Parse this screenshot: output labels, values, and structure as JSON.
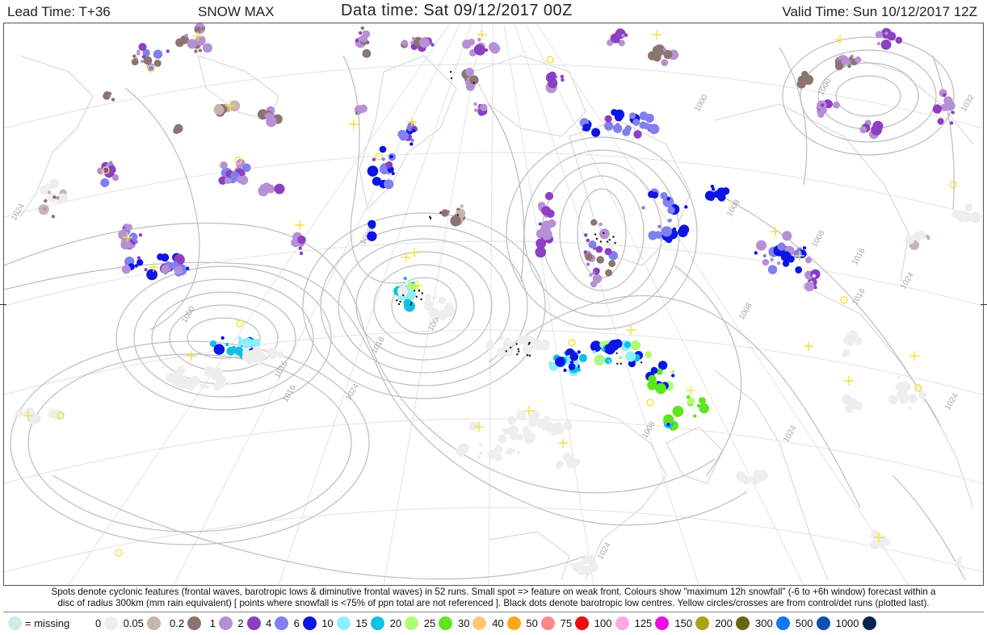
{
  "header": {
    "lead_time": "Lead Time: T+36",
    "product": "SNOW MAX",
    "data_time": "Data time:  Sat 09/12/2017 00Z",
    "valid_time": "Valid Time: Sun 10/12/2017 12Z"
  },
  "caption": {
    "line1": "Spots denote cyclonic features (frontal waves, barotropic lows & diminutive frontal waves) in 52 runs. Small spot => feature on weak front. Colours show \"maximum 12h snowfall\" (-6 to +6h window) forecast within a",
    "line2": "disc of radius 300km (mm rain equivalent) [ points where snowfall is <75% of ppn total are not referenced ]. Black dots denote barotropic low centres. Yellow circles/crosses are from control/det runs (plotted last)."
  },
  "legend": {
    "missing_label": "= missing",
    "missing_color": "#d5e8f0",
    "items": [
      {
        "label": "0",
        "color": "#eeeeee"
      },
      {
        "label": "0.05",
        "color": "#c8b4b0"
      },
      {
        "label": "0.2",
        "color": "#8c7470"
      },
      {
        "label": "1",
        "color": "#b690d6"
      },
      {
        "label": "2",
        "color": "#8c3fc2"
      },
      {
        "label": "4",
        "color": "#8080f0"
      },
      {
        "label": "6",
        "color": "#0c14e6"
      },
      {
        "label": "10",
        "color": "#90eefc"
      },
      {
        "label": "15",
        "color": "#10c0e6"
      },
      {
        "label": "20",
        "color": "#b0fc74"
      },
      {
        "label": "25",
        "color": "#5ce61e"
      },
      {
        "label": "30",
        "color": "#fcca70"
      },
      {
        "label": "40",
        "color": "#fca818"
      },
      {
        "label": "50",
        "color": "#fc8a84"
      },
      {
        "label": "75",
        "color": "#f00a0a"
      },
      {
        "label": "100",
        "color": "#fca8ea"
      },
      {
        "label": "125",
        "color": "#f00ae6"
      },
      {
        "label": "150",
        "color": "#a8a412"
      },
      {
        "label": "200",
        "color": "#6a6610"
      },
      {
        "label": "300",
        "color": "#1078f0"
      },
      {
        "label": "500",
        "color": "#0a50b0"
      },
      {
        "label": "1000",
        "color": "#0a2250"
      }
    ]
  },
  "map": {
    "isobar_labels": [
      "1024",
      "1008",
      "1000",
      "1016",
      "1024",
      "1008",
      "1000",
      "992",
      "1008",
      "1016",
      "1024",
      "1000",
      "1008",
      "1016",
      "1024",
      "1032",
      "1024",
      "1016",
      "1024",
      "1008",
      "1000",
      "1016"
    ],
    "colors": {
      "isobar": "#bdbdbd",
      "coast": "#d2d2d2",
      "control_marker": "#f2e23a"
    }
  }
}
